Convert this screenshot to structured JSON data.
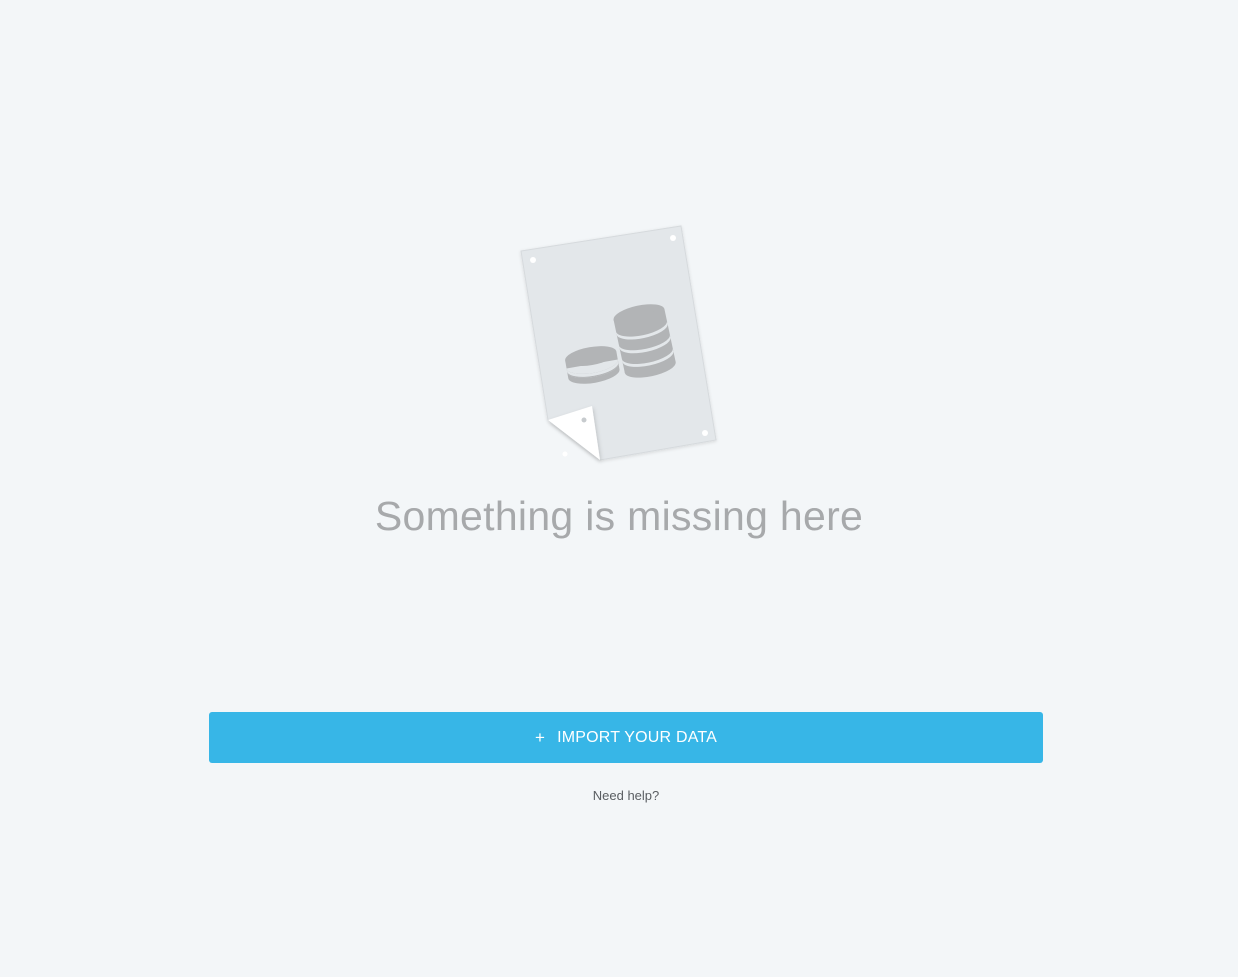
{
  "empty_state": {
    "illustration_icon": "coin-stack-document-icon",
    "title": "Something is missing here"
  },
  "import_button": {
    "icon": "plus-icon",
    "icon_glyph": "+",
    "label": "IMPORT YOUR DATA",
    "color": "#37b6e7"
  },
  "help": {
    "label": "Need help?"
  },
  "colors": {
    "background": "#f3f6f8",
    "title": "#a7a9ab",
    "paper": "#e3e7ea",
    "coins": "#b2b4b6"
  }
}
